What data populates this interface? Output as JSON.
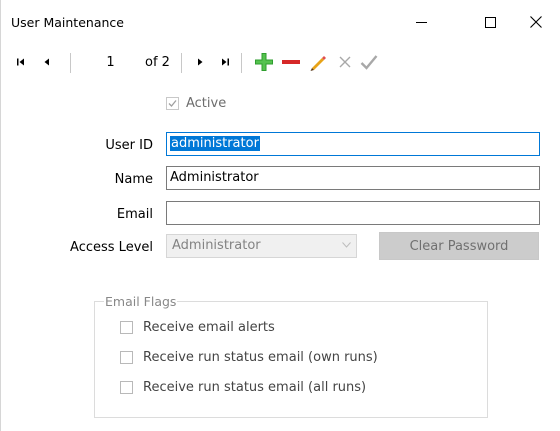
{
  "window": {
    "title": "User Maintenance",
    "controls": {
      "minimize": "minimize",
      "maximize": "maximize",
      "close": "close"
    }
  },
  "navigator": {
    "position": "1",
    "count_label": "of 2",
    "icons": [
      "first-icon",
      "previous-icon",
      "next-icon",
      "last-icon",
      "add-icon",
      "delete-icon",
      "edit-icon",
      "cancel-icon",
      "save-icon"
    ],
    "colors": {
      "add": "#2e9e2e",
      "delete": "#d62828",
      "edit": "#e8a317"
    }
  },
  "form": {
    "active_label": "Active",
    "active_checked": true,
    "user_id_label": "User ID",
    "user_id_value": "administrator",
    "name_label": "Name",
    "name_value": "Administrator",
    "email_label": "Email",
    "email_value": "",
    "access_level_label": "Access Level",
    "access_level_value": "Administrator",
    "clear_password_label": "Clear Password"
  },
  "email_flags": {
    "title": "Email Flags",
    "items": [
      {
        "label": "Receive email alerts",
        "checked": false
      },
      {
        "label": "Receive run status email (own runs)",
        "checked": false
      },
      {
        "label": "Receive run status email (all runs)",
        "checked": false
      }
    ]
  },
  "colors": {
    "focus_border": "#0078d7",
    "selection": "#0078d7",
    "disabled_text": "#838383"
  }
}
